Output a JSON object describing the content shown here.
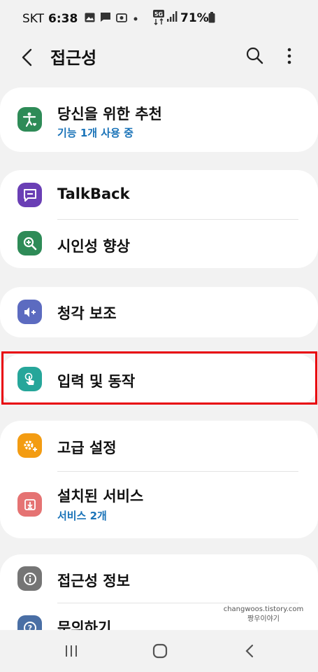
{
  "status_bar": {
    "carrier": "SKT",
    "time": "6:38",
    "network": "5G",
    "battery": "71%"
  },
  "app_bar": {
    "title": "접근성"
  },
  "menu": {
    "recommend": {
      "title": "당신을 위한 추천",
      "subtitle": "기능 1개 사용 중",
      "icon": "accessibility-person-icon",
      "color": "#2e8b57"
    },
    "talkback": {
      "title": "TalkBack",
      "icon": "chat-bubble-icon",
      "color": "#6a3fb5"
    },
    "visibility": {
      "title": "시인성 향상",
      "icon": "zoom-in-icon",
      "color": "#2e8b57"
    },
    "hearing": {
      "title": "청각 보조",
      "icon": "volume-plus-icon",
      "color": "#5c6bc0"
    },
    "interaction": {
      "title": "입력 및 동작",
      "icon": "touch-hand-icon",
      "color": "#26a69a"
    },
    "advanced": {
      "title": "고급 설정",
      "icon": "gear-plus-icon",
      "color": "#f39c12"
    },
    "installed": {
      "title": "설치된 서비스",
      "subtitle": "서비스 2개",
      "icon": "download-box-icon",
      "color": "#e57373"
    },
    "about": {
      "title": "접근성 정보",
      "icon": "info-icon",
      "color": "#757575"
    },
    "contact": {
      "title": "문의하기",
      "icon": "question-icon",
      "color": "#4a6fa5"
    }
  },
  "watermark": {
    "line1": "changwoos.tistory.com",
    "line2": "짱우이야기"
  },
  "nav_bar": {
    "recent": "recent-apps-icon",
    "home": "home-icon",
    "back": "back-icon"
  }
}
